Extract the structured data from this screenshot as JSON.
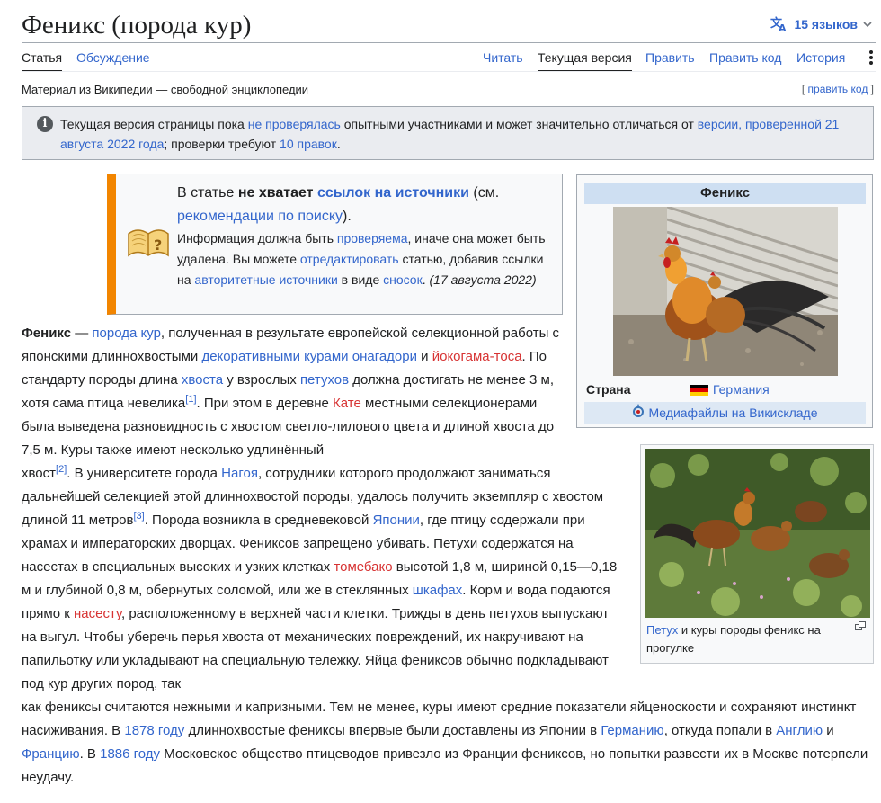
{
  "header": {
    "title": "Феникс (порода кур)",
    "languages_label": "15 языков"
  },
  "tabs": {
    "article": "Статья",
    "talk": "Обсуждение",
    "read": "Читать",
    "current": "Текущая версия",
    "edit": "Править",
    "edit_source": "Править код",
    "history": "История"
  },
  "tagline": {
    "text": "Материал из Википедии — свободной энциклопедии",
    "edit_code_left": "[ ",
    "edit_code": "править код",
    "edit_code_right": " ]"
  },
  "notice": {
    "p1": "Текущая версия страницы пока ",
    "link1": "не проверялась",
    "p2": " опытными участниками и может значительно отличаться от ",
    "link2": "версии, проверенной 21 августа 2022 года",
    "p3": "; проверки требуют ",
    "link3": "10 правок",
    "p4": "."
  },
  "ambox": {
    "a": "В статье ",
    "b": "не хватает",
    "c": " ",
    "d": "ссылок на источники",
    "e": " (см.",
    "f": "рекомендации по поиску",
    "g": ").",
    "h": "Информация должна быть ",
    "i": "проверяема",
    "j": ", иначе она может быть удалена. Вы можете ",
    "k": "отредактировать",
    "l": " статью, добавив ссылки на ",
    "m": "авторитетные источники",
    "n": " в виде ",
    "o": "сносок",
    "p": ". ",
    "q": "(17 августа 2022)"
  },
  "infobox": {
    "header": "Феникс",
    "country_label": "Страна",
    "country": "Германия",
    "commons": "Медиафайлы на Викискладе"
  },
  "thumb": {
    "caption_link": "Петух",
    "caption_rest": " и куры породы феникс на прогулке"
  },
  "article": {
    "p1": {
      "bold": "Феникс",
      "t1": " — ",
      "l1": "порода кур",
      "t2": ", полученная в результате европейской селекционной работы с японскими длиннохвостыми ",
      "l2": "декоративными курами онагадори",
      "t3": " и ",
      "r1": "йокогама-тоса",
      "t4": ". По стандарту породы длина ",
      "l3": "хвоста",
      "t5": " у взрослых ",
      "l4": "петухов",
      "t6": " должна достигать не менее 3 м, хотя сама птица невелика",
      "s1": "[1]",
      "t7": ". При этом в деревне ",
      "r2": "Кате",
      "t8": " местными селекционерами была выведена разновидность с хвостом светло-лилового цвета и длиной хвоста до 7,5 м. Куры также имеют несколько удлинённый"
    },
    "p2": {
      "t1": "хвост",
      "s2": "[2]",
      "t2": ". В университете города ",
      "l1": "Нагоя",
      "t3": ", сотрудники которого продолжают заниматься дальнейшей селекцией этой длиннохвостой породы, удалось получить экземпляр с хвостом длиной 11 метров",
      "s3": "[3]",
      "t4": ". Порода возникла в средневековой ",
      "l2": "Японии",
      "t5": ", где птицу содержали при храмах и императорских дворцах. Фениксов запрещено убивать. Петухи содержатся на насестах в специальных высоких и узких клетках ",
      "r1": "томебако",
      "t6": " высотой 1,8 м, шириной 0,15—0,18 м и глубиной 0,8 м, обернутых соломой, или же в стеклянных ",
      "l3": "шкафах",
      "t7": ". Корм и вода подаются прямо к ",
      "r2": "насесту",
      "t8": ", расположенному в верхней части клетки. Трижды в день петухов выпускают на выгул. Чтобы уберечь перья хвоста от механических повреждений, их накручивают на папильотку или укладывают на специальную тележку. Яйца фениксов обычно подкладывают под кур других пород, так"
    },
    "p3": {
      "t1": "как фениксы считаются нежными и капризными. Тем не менее, куры имеют средние показатели яйценоскости и сохраняют инстинкт насиживания. В ",
      "l1": "1878 году",
      "t2": " длиннохвостые фениксы впервые были доставлены из Японии в ",
      "l2": "Германию",
      "t3": ", откуда попали в ",
      "l3": "Англию",
      "t4": " и ",
      "l4": "Францию",
      "t5": ". В ",
      "l5": "1886 году",
      "t6": " Московское общество птицеводов привезло из Франции фениксов, но попытки развести их в Москве потерпели неудачу."
    }
  },
  "colors": {
    "link": "#3366cc",
    "redlink": "#d73333",
    "ambox_stripe": "#f28500",
    "infobox_header": "#cedff2",
    "notice_bg": "#eaecf0"
  }
}
